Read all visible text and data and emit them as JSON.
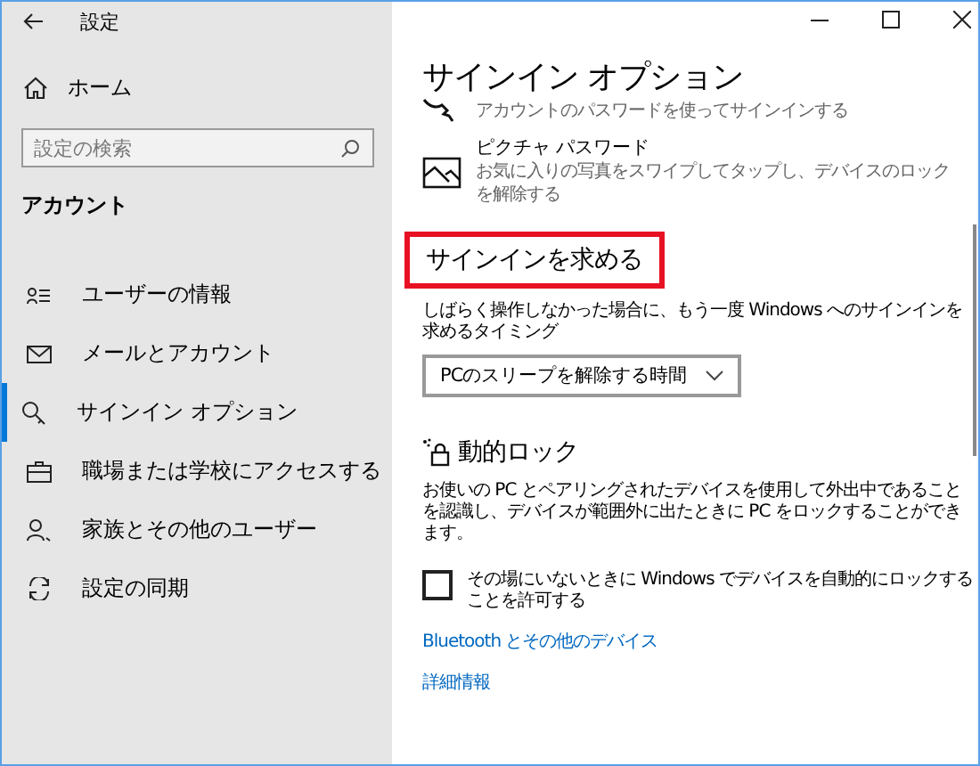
{
  "window": {
    "title": "設定"
  },
  "sidebar": {
    "home": "ホーム",
    "search": {
      "placeholder": "設定の検索"
    },
    "section": "アカウント",
    "items": [
      {
        "label": "ユーザーの情報",
        "selected": false
      },
      {
        "label": "メールとアカウント",
        "selected": false
      },
      {
        "label": "サインイン オプション",
        "selected": true
      },
      {
        "label": "職場または学校にアクセスする",
        "selected": false
      },
      {
        "label": "家族とその他のユーザー",
        "selected": false
      },
      {
        "label": "設定の同期",
        "selected": false
      }
    ]
  },
  "page": {
    "title": "サインイン オプション",
    "options": [
      {
        "description": "アカウントのパスワードを使ってサインインする"
      },
      {
        "title": "ピクチャ パスワード",
        "description": "お気に入りの写真をスワイプしてタップし、デバイスのロックを解除する"
      }
    ],
    "require_signin": {
      "heading": "サインインを求める",
      "highlighted": true,
      "description": "しばらく操作しなかった場合に、もう一度 Windows へのサインインを求めるタイミング",
      "dropdown": "PCのスリープを解除する時間"
    },
    "dynamic_lock": {
      "heading": "動的ロック",
      "description": "お使いの PC とペアリングされたデバイスを使用して外出中であることを認識し、デバイスが範囲外に出たときに PC をロックすることができます。",
      "checkbox": {
        "label": "その場にいないときに Windows でデバイスを自動的にロックすることを許可する",
        "checked": false
      }
    },
    "links": [
      "Bluetooth とその他のデバイス",
      "詳細情報"
    ]
  }
}
